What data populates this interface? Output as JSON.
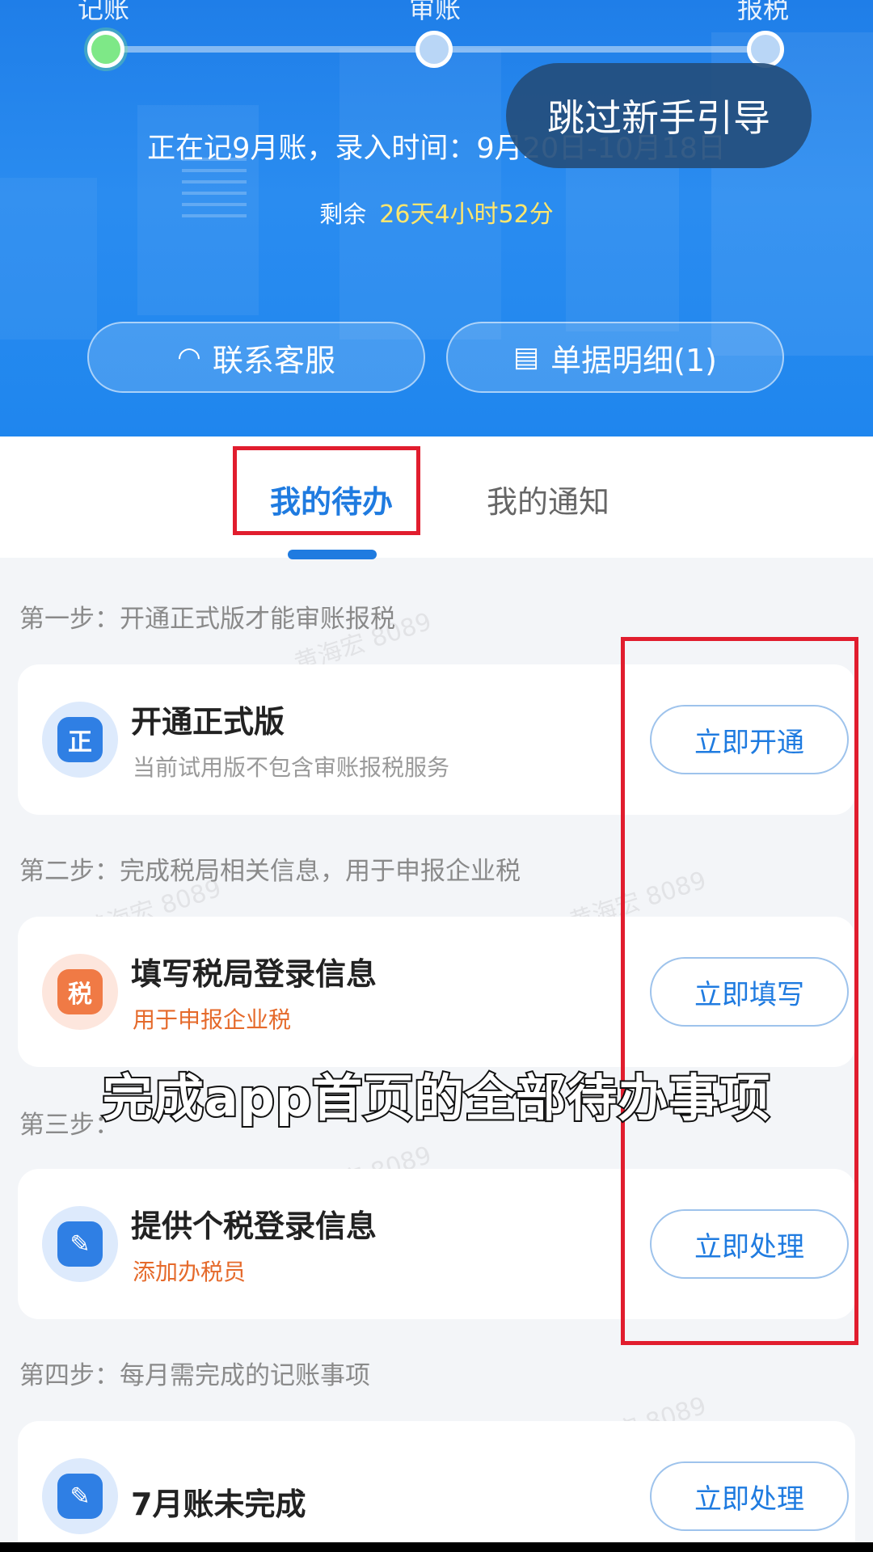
{
  "progress": {
    "steps": [
      "记账",
      "审账",
      "报税"
    ],
    "current_step_index": 0
  },
  "skip_guide_label": "跳过新手引导",
  "period": {
    "text": "正在记9月账，录入时间：9月20日-10月18日",
    "remaining_label": "剩余",
    "remaining_value": "26天4小时52分"
  },
  "header_buttons": {
    "contact_label": "联系客服",
    "receipts_label": "单据明细(1)"
  },
  "tabs": [
    {
      "label": "我的待办",
      "active": true
    },
    {
      "label": "我的通知",
      "active": false
    }
  ],
  "todo": [
    {
      "step_label": "第一步：开通正式版才能审账报税",
      "title": "开通正式版",
      "subtitle": "当前试用版不包含审账报税服务",
      "subtitle_color": "gray",
      "icon": "badge-icon",
      "icon_glyph": "正",
      "action": "立即开通"
    },
    {
      "step_label": "第二步：完成税局相关信息，用于申报企业税",
      "title": "填写税局登录信息",
      "subtitle": "用于申报企业税",
      "subtitle_color": "orange",
      "icon": "tax-document-icon",
      "icon_glyph": "税",
      "action": "立即填写"
    },
    {
      "step_label": "第三步：",
      "title": "提供个税登录信息",
      "subtitle": "添加办税员",
      "subtitle_color": "orange",
      "icon": "pencil-icon",
      "icon_glyph": "✎",
      "action": "立即处理"
    },
    {
      "step_label": "第四步：每月需完成的记账事项",
      "title": "7月账未完成",
      "subtitle": "",
      "icon": "edit-document-icon",
      "icon_glyph": "✎",
      "action": "立即处理"
    }
  ],
  "caption": "完成app首页的全部待办事项",
  "watermark": "黄海宏 8089",
  "colors": {
    "primary_blue": "#1f7be0",
    "header_blue": "#2a8cf0",
    "highlight_yellow": "#ffe66d",
    "orange": "#e56a2b",
    "annotation_red": "#e11d2e"
  }
}
